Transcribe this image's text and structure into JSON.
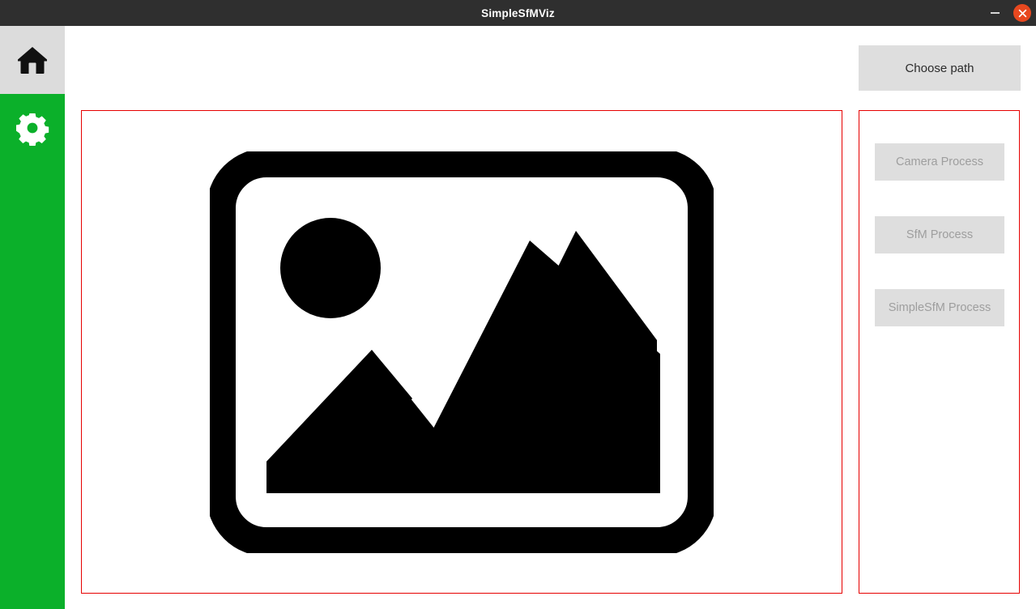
{
  "window": {
    "title": "SimpleSfMViz",
    "minimize_label": "minimize",
    "close_label": "close",
    "accent_green": "#0bb02a",
    "close_button_color": "#e8481f",
    "panel_border_color": "#e60000",
    "titlebar_color": "#2f2f2f"
  },
  "sidebar": {
    "items": [
      {
        "name": "home",
        "icon": "home-icon",
        "active": true
      },
      {
        "name": "settings",
        "icon": "gear-icon",
        "active": false
      }
    ]
  },
  "toolbar": {
    "choose_path_label": "Choose path"
  },
  "image_panel": {
    "placeholder_icon": "image-placeholder-icon"
  },
  "process_panel": {
    "buttons": [
      {
        "label": "Camera Process",
        "enabled": false
      },
      {
        "label": "SfM Process",
        "enabled": false
      },
      {
        "label": "SimpleSfM Process",
        "enabled": false
      }
    ]
  }
}
